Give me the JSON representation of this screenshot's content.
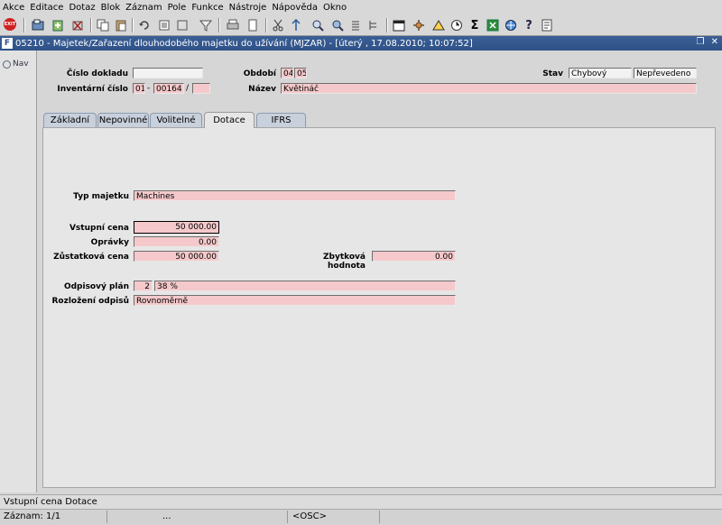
{
  "menu": [
    "Akce",
    "Editace",
    "Dotaz",
    "Blok",
    "Záznam",
    "Pole",
    "Funkce",
    "Nástroje",
    "Nápověda",
    "Okno"
  ],
  "toolbar": {
    "exit_label": "EXIT",
    "icons": [
      "save-icon",
      "new-record-icon",
      "delete-icon",
      "copy-icon",
      "paste-icon",
      "undo-icon",
      "filter-icon",
      "print-icon",
      "list-icon",
      "cut-icon",
      "insert-icon",
      "search-icon",
      "zoom-icon",
      "attach-icon",
      "settings-icon",
      "warning-icon",
      "clock-icon",
      "sum-icon",
      "excel-icon",
      "browser-icon",
      "help-icon",
      "info-icon"
    ]
  },
  "window": {
    "title": "05210 - Majetek/Zařazení dlouhodobého majetku do užívání (MJZAR) - [úterý  , 17.08.2010; 10:07:52]",
    "controls": [
      "restore-icon",
      "close-icon"
    ]
  },
  "nav": {
    "label": "Nav"
  },
  "header": {
    "cislo_dokladu_label": "Číslo dokladu",
    "cislo_dokladu_value": "",
    "inventarni_cislo_label": "Inventární číslo",
    "inv_part1": "01",
    "inv_dash": "-",
    "inv_part2": "00164",
    "inv_slash": "/",
    "inv_part3": "",
    "obdobi_label": "Období",
    "obdobi_month": "04",
    "obdobi_year": "05",
    "nazev_label": "Název",
    "nazev_value": "Květináč",
    "stav_label": "Stav",
    "stav_value1": "Chybový",
    "stav_value2": "Nepřevedeno"
  },
  "tabs": [
    "Základní",
    "Nepovinné",
    "Volitelné",
    "Dotace",
    "IFRS"
  ],
  "active_tab": "Dotace",
  "form": {
    "typ_majetku_label": "Typ majetku",
    "typ_majetku_value": "Machines",
    "vstupni_cena_label": "Vstupní cena",
    "vstupni_cena_value": "50 000.00",
    "opravky_label": "Oprávky",
    "opravky_value": "0.00",
    "zustatkova_cena_label": "Zůstatková cena",
    "zustatkova_cena_value": "50 000.00",
    "zbytkova_hodnota_label": "Zbytková hodnota",
    "zbytkova_hodnota_value": "0.00",
    "odpisovy_plan_label": "Odpisový plán",
    "odpisovy_plan_code": "2",
    "odpisovy_plan_value": "38 %",
    "rozlozeni_label": "Rozložení odpisů",
    "rozlozeni_value": "Rovnoměrně"
  },
  "status": {
    "message": "Vstupní cena Dotace",
    "record": "Záznam: 1/1",
    "dots": "...",
    "osc": "<OSC>"
  }
}
